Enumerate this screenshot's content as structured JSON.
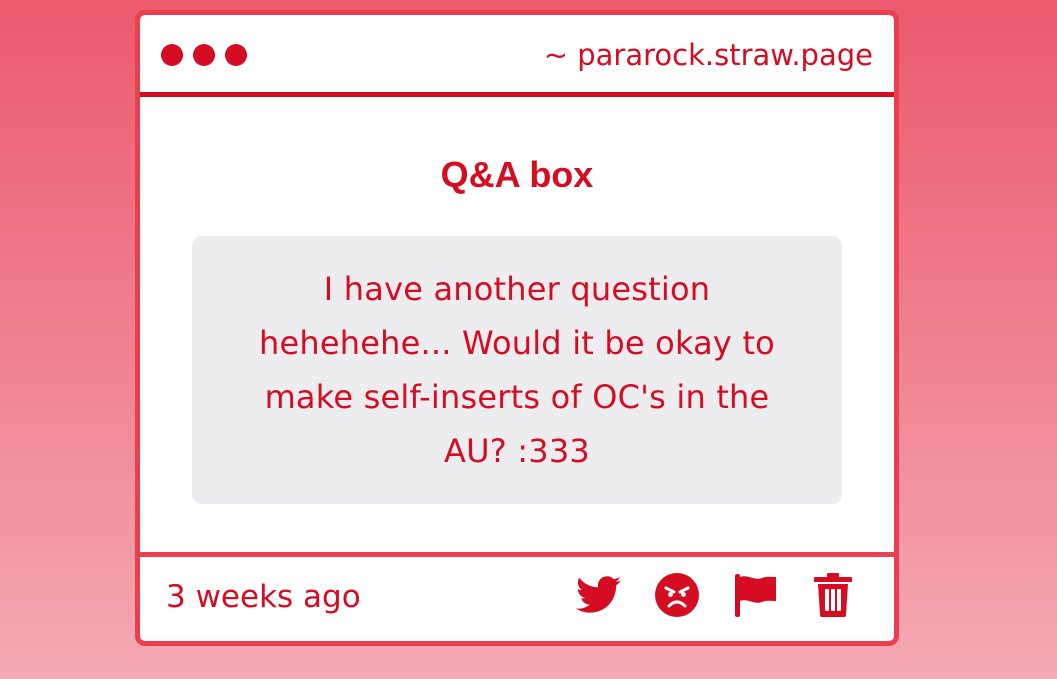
{
  "window": {
    "url": "~ pararock.straw.page"
  },
  "main": {
    "title": "Q&A box",
    "question": "I have another question hehehehe... Would it be okay to make self-inserts of OC's in the AU? :333"
  },
  "footer": {
    "timestamp": "3 weeks ago",
    "actions": [
      {
        "icon": "twitter-icon"
      },
      {
        "icon": "angry-face-icon"
      },
      {
        "icon": "flag-icon"
      },
      {
        "icon": "trash-icon"
      }
    ]
  },
  "colors": {
    "accent": "#d50d22",
    "border": "#e8404f",
    "question_bg": "#edecee",
    "card_bg": "#ffffff"
  }
}
